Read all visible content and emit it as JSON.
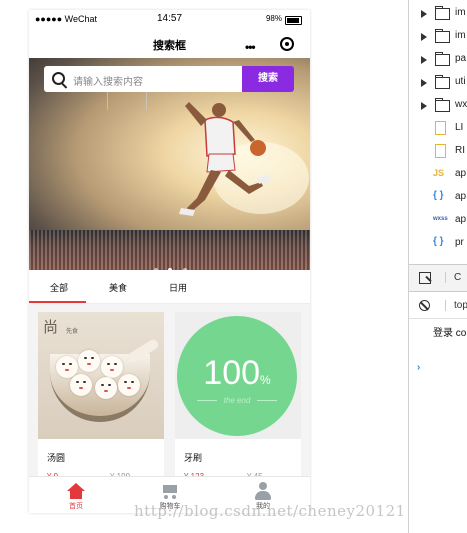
{
  "status_bar": {
    "carrier": "●●●●● WeChat",
    "time": "14:57",
    "battery": "98%"
  },
  "nav": {
    "title": "搜索框",
    "more": "•••"
  },
  "search": {
    "placeholder": "请输入搜索内容",
    "button": "搜索"
  },
  "banner": {
    "slides": 3,
    "active_slide": 2
  },
  "tabs": [
    {
      "label": "全部",
      "active": true
    },
    {
      "label": "美食",
      "active": false
    },
    {
      "label": "日用",
      "active": false
    }
  ],
  "products": [
    {
      "name": "汤圆",
      "price": "¥ 9",
      "original_price": "¥ 199",
      "image_brand": "尚",
      "image_brand_small": "先食"
    },
    {
      "name": "牙刷",
      "price": "¥ 123",
      "original_price": "¥ 45",
      "image_number": "100",
      "image_unit": "%",
      "image_caption": "the end"
    }
  ],
  "tabbar": [
    {
      "label": "首页",
      "active": true
    },
    {
      "label": "购物车",
      "active": false
    },
    {
      "label": "我的",
      "active": false
    }
  ],
  "devtools": {
    "tree": [
      {
        "type": "folder",
        "name": "im"
      },
      {
        "type": "folder",
        "name": "im"
      },
      {
        "type": "folder",
        "name": "pa"
      },
      {
        "type": "folder",
        "name": "uti"
      },
      {
        "type": "folder",
        "name": "wx"
      },
      {
        "type": "file",
        "name": "LI"
      },
      {
        "type": "file",
        "name": "RI"
      },
      {
        "type": "js",
        "badge": "JS",
        "name": "ap"
      },
      {
        "type": "json",
        "badge": "{ }",
        "name": "ap"
      },
      {
        "type": "wxss",
        "badge": "wxss",
        "name": "ap"
      },
      {
        "type": "json",
        "badge": "{ }",
        "name": "pr"
      }
    ],
    "console_tab": "C",
    "filter_text": "top",
    "log": "登录 co",
    "prompt": "›"
  },
  "watermark": "http://blog.csdn.net/cheney20121"
}
